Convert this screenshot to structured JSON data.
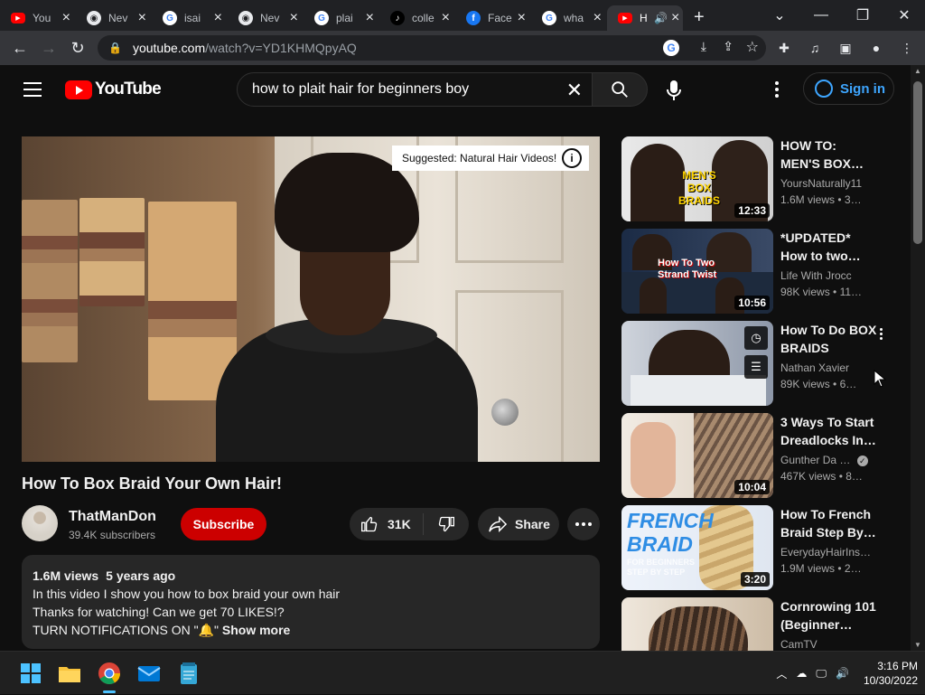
{
  "browser": {
    "tabs": [
      {
        "title": "You",
        "fav_color": "#ff0000",
        "fav_glyph": "▶"
      },
      {
        "title": "Nev",
        "fav_color": "#e8eaed",
        "fav_glyph": "◉"
      },
      {
        "title": "isai",
        "fav_color": "#e8eaed",
        "fav_glyph": "G"
      },
      {
        "title": "Nev",
        "fav_color": "#e8eaed",
        "fav_glyph": "◉"
      },
      {
        "title": "plai",
        "fav_color": "#e8eaed",
        "fav_glyph": "G"
      },
      {
        "title": "colle",
        "fav_color": "#000000",
        "fav_glyph": "♪"
      },
      {
        "title": "Face",
        "fav_color": "#1877f2",
        "fav_glyph": "f"
      },
      {
        "title": "wha",
        "fav_color": "#e8eaed",
        "fav_glyph": "G"
      },
      {
        "title": "H",
        "fav_color": "#ff0000",
        "fav_glyph": "▶"
      }
    ],
    "url_host": "youtube.com",
    "url_path": "/watch?v=YD1KHMQpyAQ"
  },
  "header": {
    "logo_text": "YouTube",
    "search_value": "how to plait hair for beginners  boy",
    "signin_label": "Sign in"
  },
  "player": {
    "suggestion": "Suggested: Natural Hair Videos!"
  },
  "video": {
    "title": "How To Box Braid Your Own Hair!",
    "channel": "ThatManDon",
    "subscribers": "39.4K subscribers",
    "subscribe_label": "Subscribe",
    "likes": "31K",
    "share_label": "Share",
    "views": "1.6M views",
    "age": "5 years ago",
    "desc_lines": [
      "In this video I show you how to box braid your own hair",
      "Thanks for watching! Can we get 70 LIKES!?",
      "TURN NOTIFICATIONS ON \"🔔\""
    ],
    "show_more": "Show more"
  },
  "recommendations": [
    {
      "title_1": "HOW TO:",
      "title_2": "MEN'S BOX…",
      "channel": "YoursNaturally11",
      "views": "1.6M views",
      "age": "3…",
      "duration": "12:33",
      "thumb_text": "MEN'S BOX BRAIDS"
    },
    {
      "title_1": "*UPDATED*",
      "title_2": "How to two…",
      "channel": "Life With Jrocc",
      "views": "98K views",
      "age": "11…",
      "duration": "10:56",
      "thumb_text": "How To Two Strand Twist"
    },
    {
      "title_1": "How To Do BOX",
      "title_2": "BRAIDS",
      "channel": "Nathan Xavier",
      "views": "89K views",
      "age": "6…",
      "duration": "",
      "thumb_text": ""
    },
    {
      "title_1": "3 Ways To Start",
      "title_2": "Dreadlocks In…",
      "channel": "Gunther Da …",
      "views": "467K views",
      "age": "8…",
      "duration": "10:04",
      "thumb_text": ""
    },
    {
      "title_1": "How To French",
      "title_2": "Braid Step By…",
      "channel": "EverydayHairIns…",
      "views": "1.9M views",
      "age": "2…",
      "duration": "3:20",
      "thumb_text": "FRENCH BRAID",
      "thumb_sub": "FOR BEGINNERS STEP BY STEP"
    },
    {
      "title_1": "Cornrowing 101",
      "title_2": "(Beginner…",
      "channel": "CamTV",
      "views": "",
      "age": "",
      "duration": "",
      "thumb_text": ""
    }
  ],
  "taskbar": {
    "time": "3:16 PM",
    "date": "10/30/2022"
  },
  "colors": {
    "brand_red": "#ff0000",
    "subscribe_red": "#cc0000",
    "link_blue": "#3ea6ff",
    "page_bg": "#0f0f0f"
  }
}
